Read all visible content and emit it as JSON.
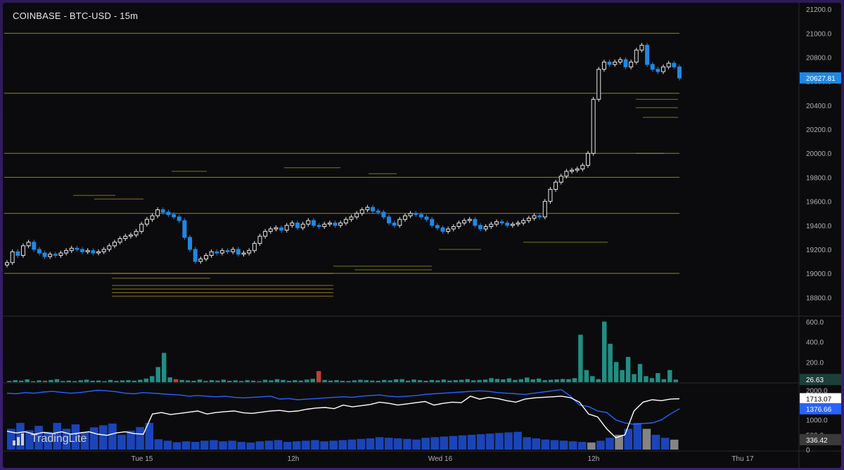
{
  "header": {
    "title": "COINBASE - BTC-USD - 15m"
  },
  "brand": {
    "name": "TradingLite"
  },
  "colors": {
    "up": "#26a69a",
    "down": "#1e88e5",
    "volume_up": "#26a69a",
    "volume_down": "#e04a3a",
    "level": "#b5a11a",
    "price_label": "#1e88e5",
    "line_white": "#ffffff",
    "line_blue": "#2962ff"
  },
  "chart_data": [
    {
      "type": "line",
      "name": "price",
      "title": "COINBASE - BTC-USD - 15m",
      "x_ticks": [
        "Tue 15",
        "12h",
        "Wed 16",
        "12h",
        "Thu 17"
      ],
      "y_ticks": [
        "21200.0",
        "21000.0",
        "20800.0",
        "20600.0",
        "20400.0",
        "20200.0",
        "20000.0",
        "19800.0",
        "19600.0",
        "19400.0",
        "19200.0",
        "19000.0",
        "18800.0"
      ],
      "ylim": [
        18650,
        21230
      ],
      "last_price": "20627.81",
      "close_series": [
        19090,
        19180,
        19150,
        19230,
        19260,
        19200,
        19170,
        19140,
        19160,
        19150,
        19170,
        19190,
        19210,
        19200,
        19180,
        19190,
        19170,
        19180,
        19200,
        19230,
        19260,
        19290,
        19310,
        19320,
        19350,
        19410,
        19450,
        19480,
        19530,
        19510,
        19490,
        19470,
        19440,
        19300,
        19200,
        19100,
        19120,
        19150,
        19180,
        19170,
        19190,
        19180,
        19200,
        19160,
        19170,
        19190,
        19250,
        19310,
        19350,
        19370,
        19380,
        19360,
        19400,
        19420,
        19380,
        19410,
        19440,
        19400,
        19390,
        19410,
        19420,
        19400,
        19420,
        19450,
        19470,
        19500,
        19530,
        19550,
        19520,
        19510,
        19470,
        19420,
        19400,
        19450,
        19480,
        19500,
        19490,
        19470,
        19450,
        19400,
        19380,
        19350,
        19370,
        19390,
        19420,
        19440,
        19450,
        19400,
        19370,
        19390,
        19410,
        19430,
        19420,
        19400,
        19410,
        19420,
        19440,
        19460,
        19480,
        19470,
        19600,
        19700,
        19760,
        19810,
        19850,
        19860,
        19870,
        19900,
        20000,
        20450,
        20700,
        20760,
        20740,
        20760,
        20780,
        20720,
        20760,
        20860,
        20900,
        20740,
        20700,
        20680,
        20720,
        20750,
        20720,
        20627
      ],
      "levels": [
        21000,
        20500,
        20000,
        19800,
        19500,
        19000
      ]
    },
    {
      "type": "bar",
      "name": "volume",
      "y_ticks": [
        "600.0",
        "400.0",
        "200.0"
      ],
      "ylim": [
        0,
        640
      ],
      "last_value": "26.63",
      "values": [
        12,
        20,
        15,
        28,
        10,
        18,
        14,
        22,
        30,
        12,
        16,
        11,
        19,
        25,
        14,
        17,
        10,
        22,
        13,
        18,
        20,
        15,
        24,
        36,
        60,
        150,
        290,
        48,
        30,
        22,
        18,
        14,
        26,
        12,
        20,
        16,
        25,
        14,
        18,
        12,
        20,
        15,
        10,
        24,
        18,
        30,
        22,
        14,
        20,
        16,
        26,
        34,
        110,
        22,
        16,
        20,
        14,
        12,
        18,
        24,
        20,
        16,
        14,
        22,
        18,
        28,
        30,
        15,
        26,
        20,
        14,
        22,
        18,
        26,
        16,
        20,
        24,
        30,
        18,
        22,
        26,
        40,
        32,
        28,
        38,
        22,
        30,
        46,
        28,
        36,
        20,
        24,
        28,
        32,
        30,
        40,
        470,
        120,
        60,
        30,
        600,
        380,
        200,
        120,
        250,
        80,
        180,
        60,
        40,
        90,
        30,
        120,
        26
      ],
      "down_indices": [
        6,
        28,
        52
      ]
    },
    {
      "type": "line",
      "name": "indicator",
      "y_ticks": [
        "2000.0",
        "1000.0",
        "500.0",
        "0"
      ],
      "ylim": [
        0,
        2200
      ],
      "last_values": [
        "1713.07",
        "1376.66",
        "336.42"
      ],
      "white_series": [
        620,
        560,
        600,
        520,
        580,
        540,
        600,
        520,
        560,
        600,
        520,
        480,
        560,
        600,
        540,
        520,
        1200,
        1250,
        1180,
        1220,
        1260,
        1300,
        1200,
        1250,
        1280,
        1300,
        1240,
        1220,
        1260,
        1300,
        1320,
        1280,
        1300,
        1360,
        1400,
        1420,
        1380,
        1500,
        1440,
        1480,
        1520,
        1600,
        1560,
        1500,
        1540,
        1580,
        1620,
        1500,
        1560,
        1600,
        1580,
        1800,
        1700,
        1760,
        1720,
        1650,
        1600,
        1700,
        1740,
        1760,
        1780,
        1800,
        1750,
        1600,
        1200,
        1100,
        700,
        400,
        500,
        1300,
        1600,
        1680,
        1650,
        1700,
        1713
      ],
      "blue_series": [
        1900,
        1880,
        1920,
        1900,
        1940,
        1960,
        1930,
        1900,
        1920,
        1960,
        2000,
        1980,
        1950,
        1900,
        1880,
        1920,
        1900,
        1880,
        1860,
        1840,
        1800,
        1820,
        1800,
        1780,
        1800,
        1760,
        1740,
        1760,
        1780,
        1800,
        1700,
        1720,
        1680,
        1700,
        1720,
        1740,
        1760,
        1780,
        1760,
        1800,
        1820,
        1840,
        1800,
        1780,
        1800,
        1820,
        1860,
        1880,
        1900,
        1920,
        1940,
        1960,
        1980,
        1960,
        1920,
        1900,
        1880,
        1860,
        1900,
        1940,
        1980,
        2020,
        1800,
        1500,
        1450,
        1300,
        1250,
        1000,
        900,
        850,
        880,
        900,
        1000,
        1200,
        1376
      ],
      "bar_values": [
        700,
        900,
        650,
        800,
        600,
        900,
        700,
        850,
        600,
        750,
        820,
        880,
        500,
        640,
        760,
        900,
        350,
        300,
        250,
        280,
        260,
        300,
        320,
        280,
        300,
        260,
        240,
        280,
        300,
        320,
        260,
        280,
        300,
        320,
        280,
        300,
        320,
        340,
        360,
        380,
        420,
        400,
        380,
        360,
        340,
        400,
        420,
        440,
        460,
        480,
        500,
        520,
        540,
        560,
        580,
        600,
        420,
        380,
        340,
        320,
        300,
        280,
        260,
        240,
        300,
        400,
        500,
        700,
        900,
        700,
        500,
        400,
        336
      ]
    }
  ]
}
